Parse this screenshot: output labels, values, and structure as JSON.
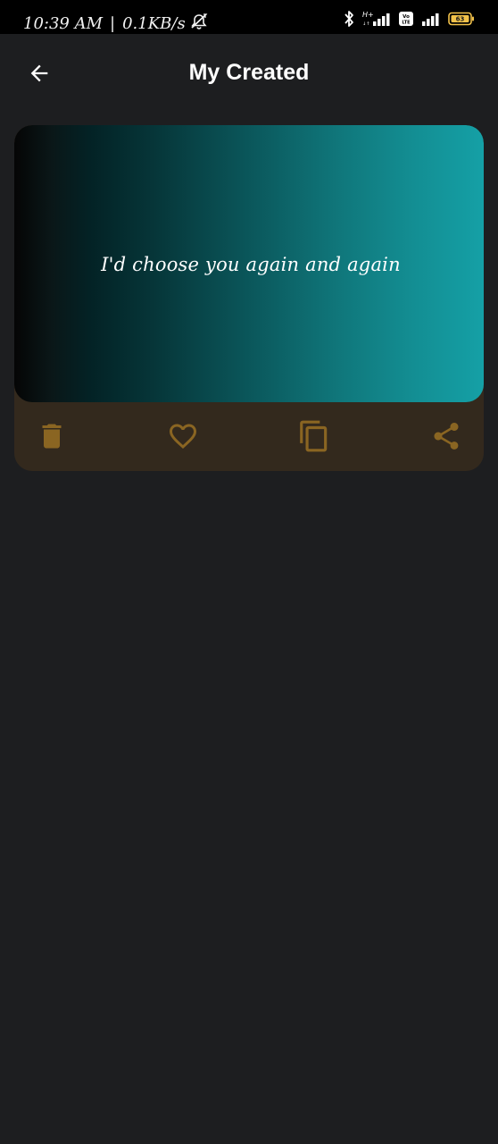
{
  "status_bar": {
    "time": "10:39 AM",
    "separator": "|",
    "network_speed": "0.1KB/s",
    "battery_level": "63",
    "network_type": "H+",
    "volte_label": "Vo LTE",
    "icons": [
      "muted-alarm-icon",
      "bluetooth-icon",
      "signal-strength-icon",
      "volte-icon",
      "battery-icon"
    ]
  },
  "header": {
    "title": "My Created",
    "back_icon": "arrow-left-icon"
  },
  "quote_card": {
    "text": "I'd choose you again and again",
    "gradient_colors": [
      "#050505",
      "#032225",
      "#0b5a5e",
      "#15a0a6"
    ],
    "actions": [
      {
        "name": "delete",
        "icon": "trash-icon"
      },
      {
        "name": "favorite",
        "icon": "heart-icon"
      },
      {
        "name": "copy",
        "icon": "copy-icon"
      },
      {
        "name": "share",
        "icon": "share-icon"
      }
    ]
  },
  "colors": {
    "background": "#1d1e20",
    "status_bar": "#000000",
    "card_action_bar": "#33291d",
    "action_icon": "#8a6522",
    "title_text": "#ffffff"
  }
}
